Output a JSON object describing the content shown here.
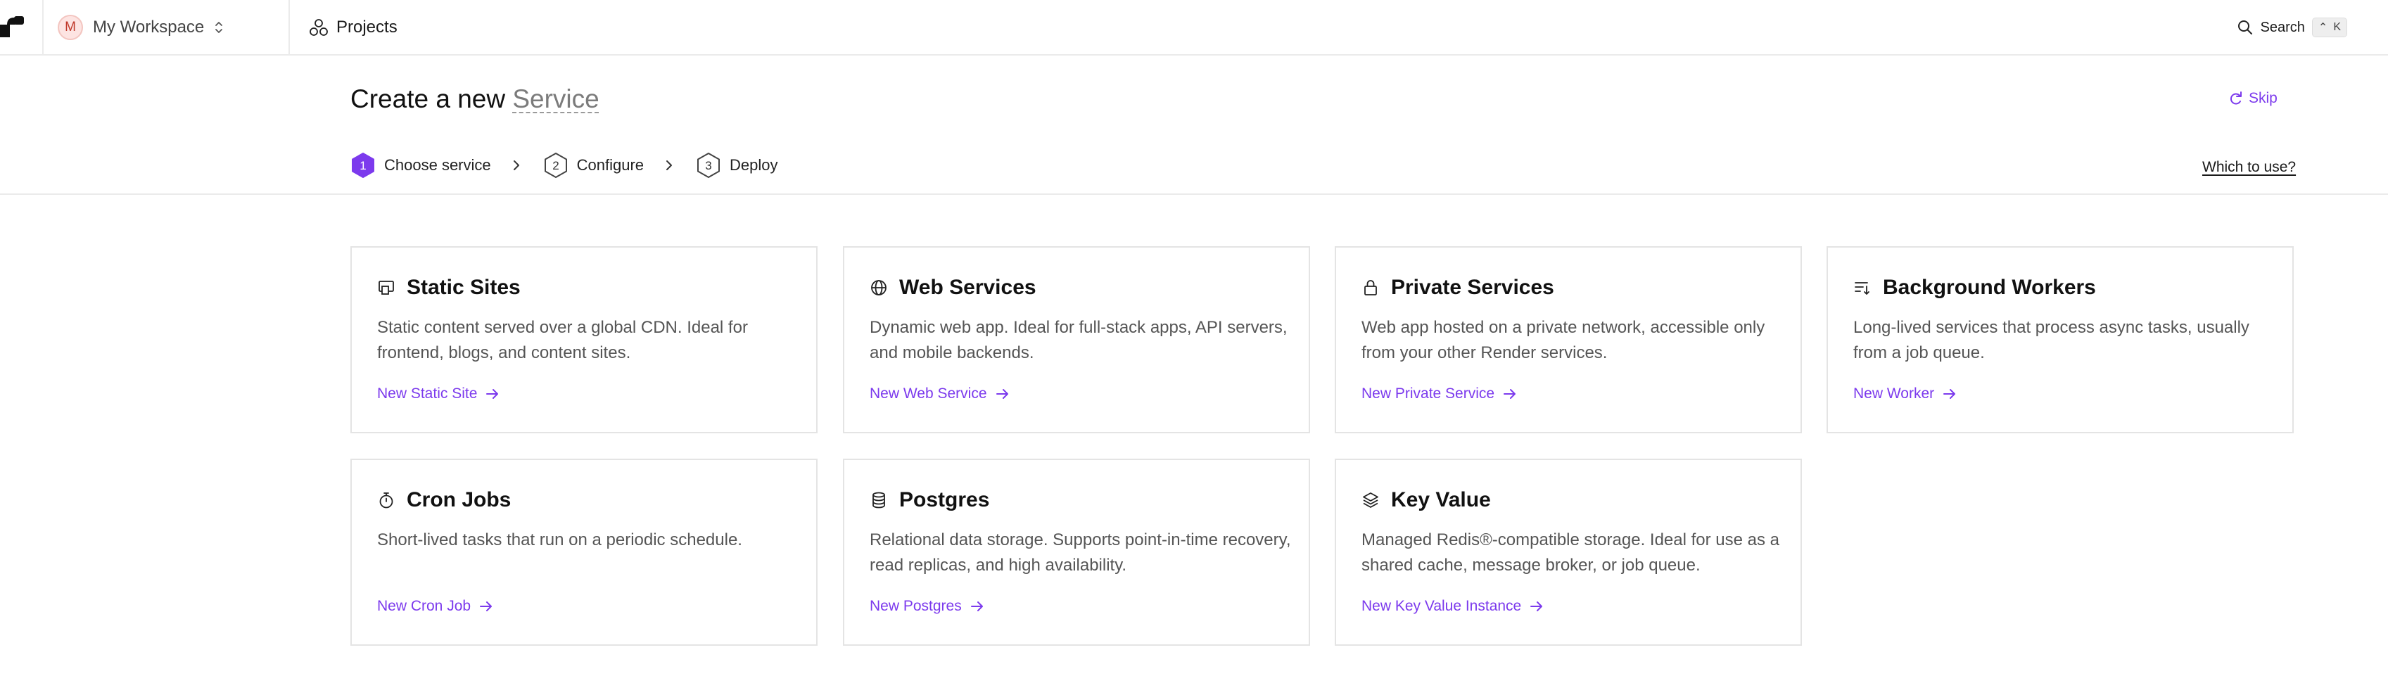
{
  "topbar": {
    "workspace_initial": "M",
    "workspace_name": "My Workspace",
    "projects_label": "Projects",
    "search_label": "Search",
    "search_shortcut_modifier": "⌃",
    "search_shortcut_key": "K"
  },
  "header": {
    "title_prefix": "Create a new",
    "title_service": "Service",
    "skip_label": "Skip",
    "which_to_use": "Which to use?"
  },
  "steps": [
    {
      "number": "1",
      "label": "Choose service",
      "active": true
    },
    {
      "number": "2",
      "label": "Configure",
      "active": false
    },
    {
      "number": "3",
      "label": "Deploy",
      "active": false
    }
  ],
  "services": [
    {
      "icon": "static-site-icon",
      "title": "Static Sites",
      "description": "Static content served over a global CDN. Ideal for frontend, blogs, and content sites.",
      "link": "New Static Site"
    },
    {
      "icon": "globe-icon",
      "title": "Web Services",
      "description": "Dynamic web app. Ideal for full-stack apps, API servers, and mobile backends.",
      "link": "New Web Service"
    },
    {
      "icon": "lock-icon",
      "title": "Private Services",
      "description": "Web app hosted on a private network, accessible only from your other Render services.",
      "link": "New Private Service"
    },
    {
      "icon": "list-arrow-icon",
      "title": "Background Workers",
      "description": "Long-lived services that process async tasks, usually from a job queue.",
      "link": "New Worker"
    },
    {
      "icon": "stopwatch-icon",
      "title": "Cron Jobs",
      "description": "Short-lived tasks that run on a periodic schedule.",
      "link": "New Cron Job"
    },
    {
      "icon": "database-icon",
      "title": "Postgres",
      "description": "Relational data storage. Supports point-in-time recovery, read replicas, and high availability.",
      "link": "New Postgres"
    },
    {
      "icon": "layers-icon",
      "title": "Key Value",
      "description": "Managed Redis®-compatible storage. Ideal for use as a shared cache, message broker, or job queue.",
      "link": "New Key Value Instance"
    }
  ],
  "colors": {
    "accent": "#7c3aed",
    "active_step": "#7c3aed",
    "border": "#e4e4e4",
    "avatar_bg": "#fde4e2"
  }
}
